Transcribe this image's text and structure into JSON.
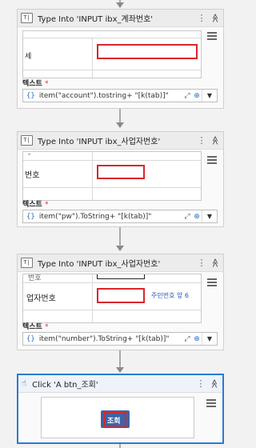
{
  "activities": [
    {
      "title": "Type Into 'INPUT  ibx_계좌번호'",
      "icon": "T|",
      "preview_label": "세",
      "field_label": "텍스트",
      "required_mark": "*",
      "expression": "item(\"account\").tostring+ \"[k(tab)]\""
    },
    {
      "title": "Type Into 'INPUT  ibx_사업자번호'",
      "icon": "T|",
      "preview_label": "번호",
      "preview_label_top": "-",
      "field_label": "텍스트",
      "required_mark": "*",
      "expression": "item(\"pw\").ToString+ \"[k(tab)]\""
    },
    {
      "title": "Type Into 'INPUT  ibx_사업자번호'",
      "icon": "T|",
      "preview_label": "업자번호",
      "preview_label_top": "번호",
      "preview_hint": "주민번호 앞 6",
      "field_label": "텍스트",
      "required_mark": "*",
      "expression": "item(\"number\").ToString+ \"[k(tab)]\""
    },
    {
      "title": "Click 'A  btn_조회'",
      "preview_button": "조회"
    }
  ],
  "icons": {
    "expression": "{}",
    "expand": "⤢",
    "add": "⊕",
    "dropdown": "▼",
    "more": "⋮",
    "collapse": "≫"
  },
  "colors": {
    "selected_border": "#2a7bd4",
    "highlight_red": "#d9262c",
    "button_blue": "#3d64a8"
  }
}
